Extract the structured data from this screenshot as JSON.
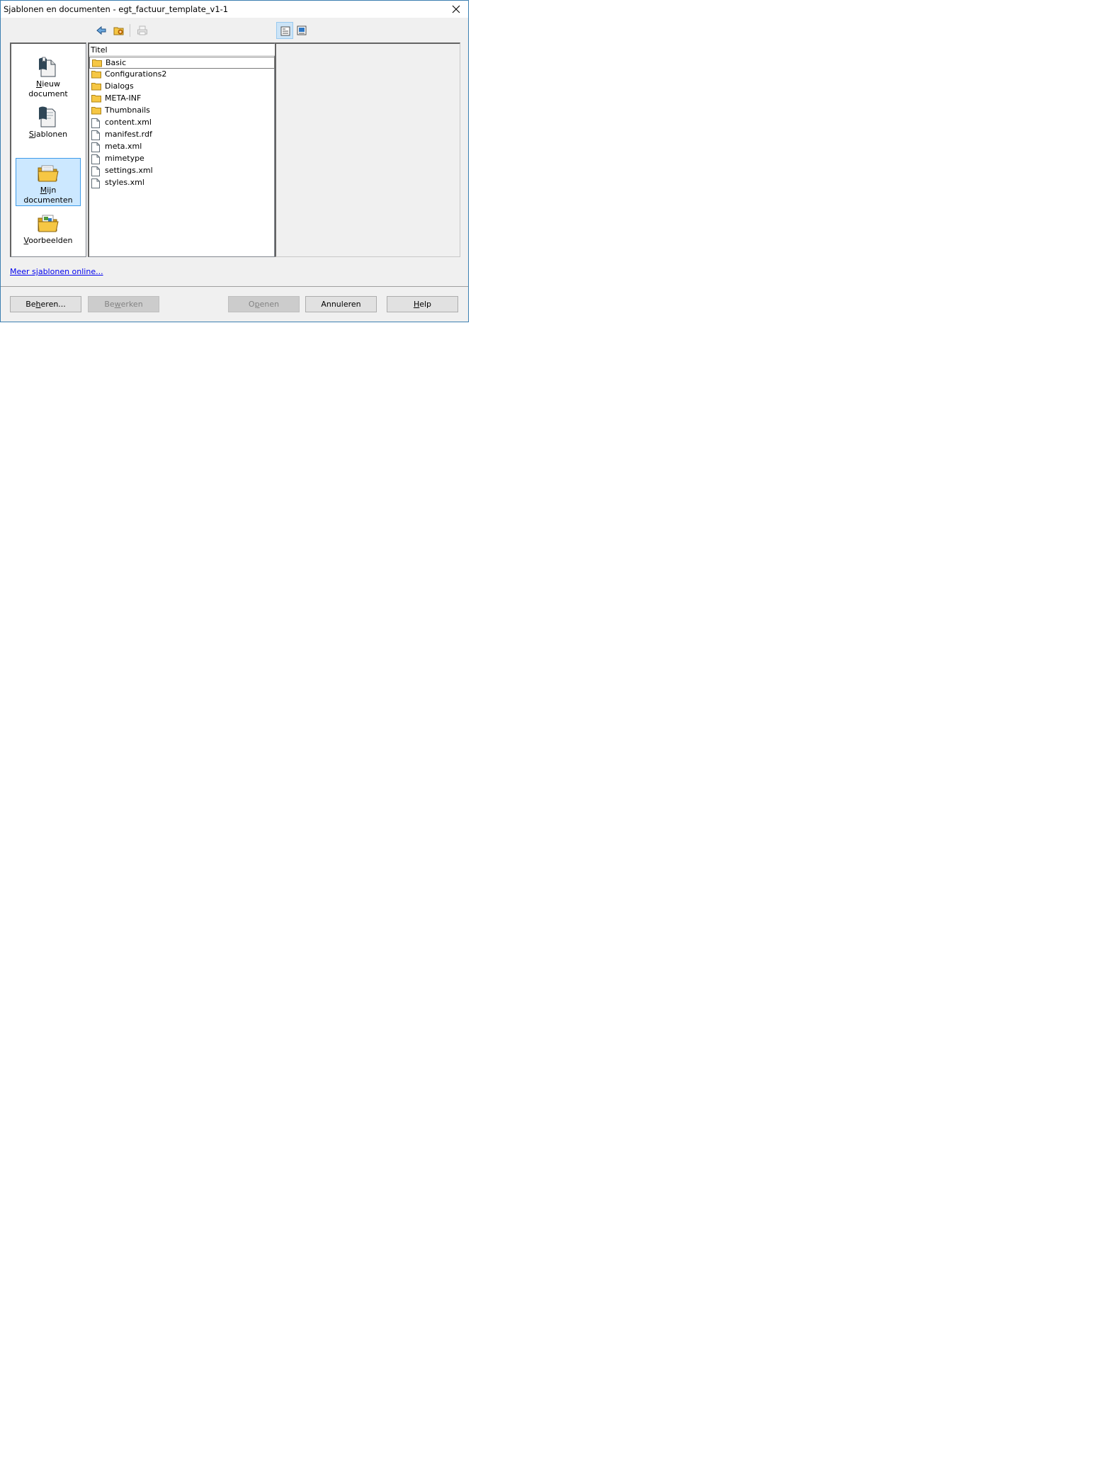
{
  "window": {
    "title": "Sjablonen en documenten - egt_factuur_template_v1-1"
  },
  "toolbar": {
    "back_icon": "back-arrow-icon",
    "up_icon": "folder-up-icon",
    "print_icon": "printer-icon",
    "document_view_icon": "document-view-icon",
    "preview_icon": "preview-icon"
  },
  "nav": {
    "items": [
      {
        "pre": "",
        "key": "N",
        "post": "ieuw",
        "line2": "document",
        "icon": "new-document-icon"
      },
      {
        "pre": "",
        "key": "S",
        "post": "jablonen",
        "line2": "",
        "icon": "templates-icon"
      },
      {
        "pre": "",
        "key": "M",
        "post": "ijn",
        "line2": "documenten",
        "icon": "my-documents-icon"
      },
      {
        "pre": "",
        "key": "V",
        "post": "oorbeelden",
        "line2": "",
        "icon": "samples-icon"
      }
    ]
  },
  "filelist": {
    "header": "Titel",
    "items": [
      {
        "name": "Basic",
        "type": "folder"
      },
      {
        "name": "Configurations2",
        "type": "folder"
      },
      {
        "name": "Dialogs",
        "type": "folder"
      },
      {
        "name": "META-INF",
        "type": "folder"
      },
      {
        "name": "Thumbnails",
        "type": "folder"
      },
      {
        "name": "content.xml",
        "type": "file"
      },
      {
        "name": "manifest.rdf",
        "type": "file"
      },
      {
        "name": "meta.xml",
        "type": "file"
      },
      {
        "name": "mimetype",
        "type": "file"
      },
      {
        "name": "settings.xml",
        "type": "file"
      },
      {
        "name": "styles.xml",
        "type": "file"
      }
    ]
  },
  "link": {
    "online": "Meer sjablonen online..."
  },
  "buttons": {
    "manage": {
      "pre": "Be",
      "key": "h",
      "post": "eren..."
    },
    "edit": {
      "pre": "Be",
      "key": "w",
      "post": "erken"
    },
    "open": {
      "pre": "O",
      "key": "p",
      "post": "enen"
    },
    "cancel": {
      "pre": "",
      "key": "",
      "post": "Annuleren"
    },
    "help": {
      "pre": "",
      "key": "H",
      "post": "elp"
    }
  }
}
